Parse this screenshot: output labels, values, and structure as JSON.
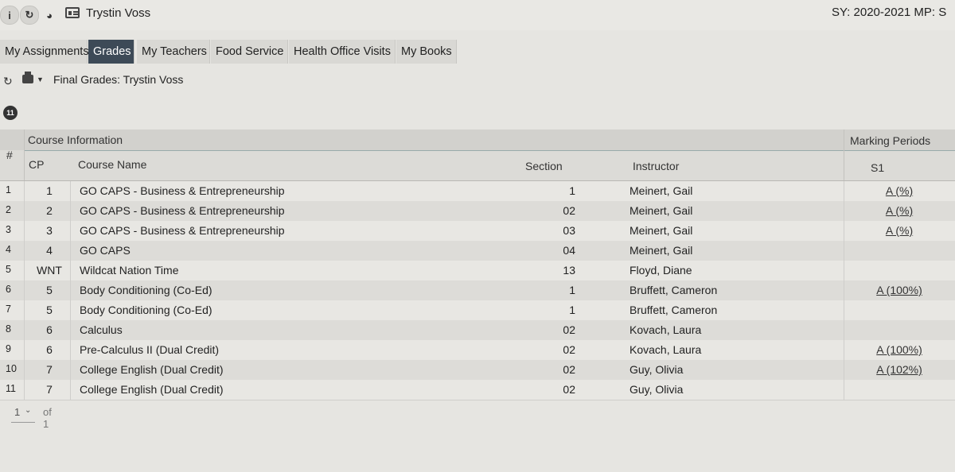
{
  "header": {
    "student_name": "Trystin Voss",
    "sy_label": "SY: 2020-2021  MP: S",
    "info_icon_glyph": "i",
    "refresh_icon_glyph": "↻",
    "chart_icon_glyph": "◕"
  },
  "tabs": [
    {
      "label": "My Assignments",
      "active": false
    },
    {
      "label": "Grades",
      "active": true
    },
    {
      "label": "My Teachers",
      "active": false
    },
    {
      "label": "Food Service",
      "active": false
    },
    {
      "label": "Health Office Visits",
      "active": false
    },
    {
      "label": "My Books",
      "active": false
    }
  ],
  "toolbar": {
    "title": "Final Grades: Trystin Voss",
    "refresh_glyph": "↻",
    "caret_glyph": "▼"
  },
  "table": {
    "count_badge": "11",
    "group_course": "Course Information",
    "group_marking": "Marking Periods",
    "col_num": "#",
    "col_cp": "CP",
    "col_course": "Course Name",
    "col_section": "Section",
    "col_instructor": "Instructor",
    "col_s1": "S1",
    "rows": [
      {
        "num": "1",
        "cp": "1",
        "course": "GO CAPS - Business & Entrepreneurship",
        "section": "1",
        "instructor": "Meinert, Gail",
        "s1": "A (%)"
      },
      {
        "num": "2",
        "cp": "2",
        "course": "GO CAPS - Business & Entrepreneurship",
        "section": "02",
        "instructor": "Meinert, Gail",
        "s1": "A (%)"
      },
      {
        "num": "3",
        "cp": "3",
        "course": "GO CAPS - Business & Entrepreneurship",
        "section": "03",
        "instructor": "Meinert, Gail",
        "s1": "A (%)"
      },
      {
        "num": "4",
        "cp": "4",
        "course": "GO CAPS",
        "section": "04",
        "instructor": "Meinert, Gail",
        "s1": ""
      },
      {
        "num": "5",
        "cp": "WNT",
        "course": "Wildcat Nation Time",
        "section": "13",
        "instructor": "Floyd, Diane",
        "s1": ""
      },
      {
        "num": "6",
        "cp": "5",
        "course": "Body Conditioning (Co-Ed)",
        "section": "1",
        "instructor": "Bruffett, Cameron",
        "s1": "A (100%)"
      },
      {
        "num": "7",
        "cp": "5",
        "course": "Body Conditioning (Co-Ed)",
        "section": "1",
        "instructor": "Bruffett, Cameron",
        "s1": ""
      },
      {
        "num": "8",
        "cp": "6",
        "course": "Calculus",
        "section": "02",
        "instructor": "Kovach, Laura",
        "s1": ""
      },
      {
        "num": "9",
        "cp": "6",
        "course": "Pre-Calculus II (Dual Credit)",
        "section": "02",
        "instructor": "Kovach, Laura",
        "s1": "A (100%)"
      },
      {
        "num": "10",
        "cp": "7",
        "course": "College English (Dual Credit)",
        "section": "02",
        "instructor": "Guy, Olivia",
        "s1": "A (102%)"
      },
      {
        "num": "11",
        "cp": "7",
        "course": "College English (Dual Credit)",
        "section": "02",
        "instructor": "Guy, Olivia",
        "s1": ""
      }
    ]
  },
  "pager": {
    "page": "1",
    "chevron": "⌄",
    "of_label": "of 1"
  }
}
